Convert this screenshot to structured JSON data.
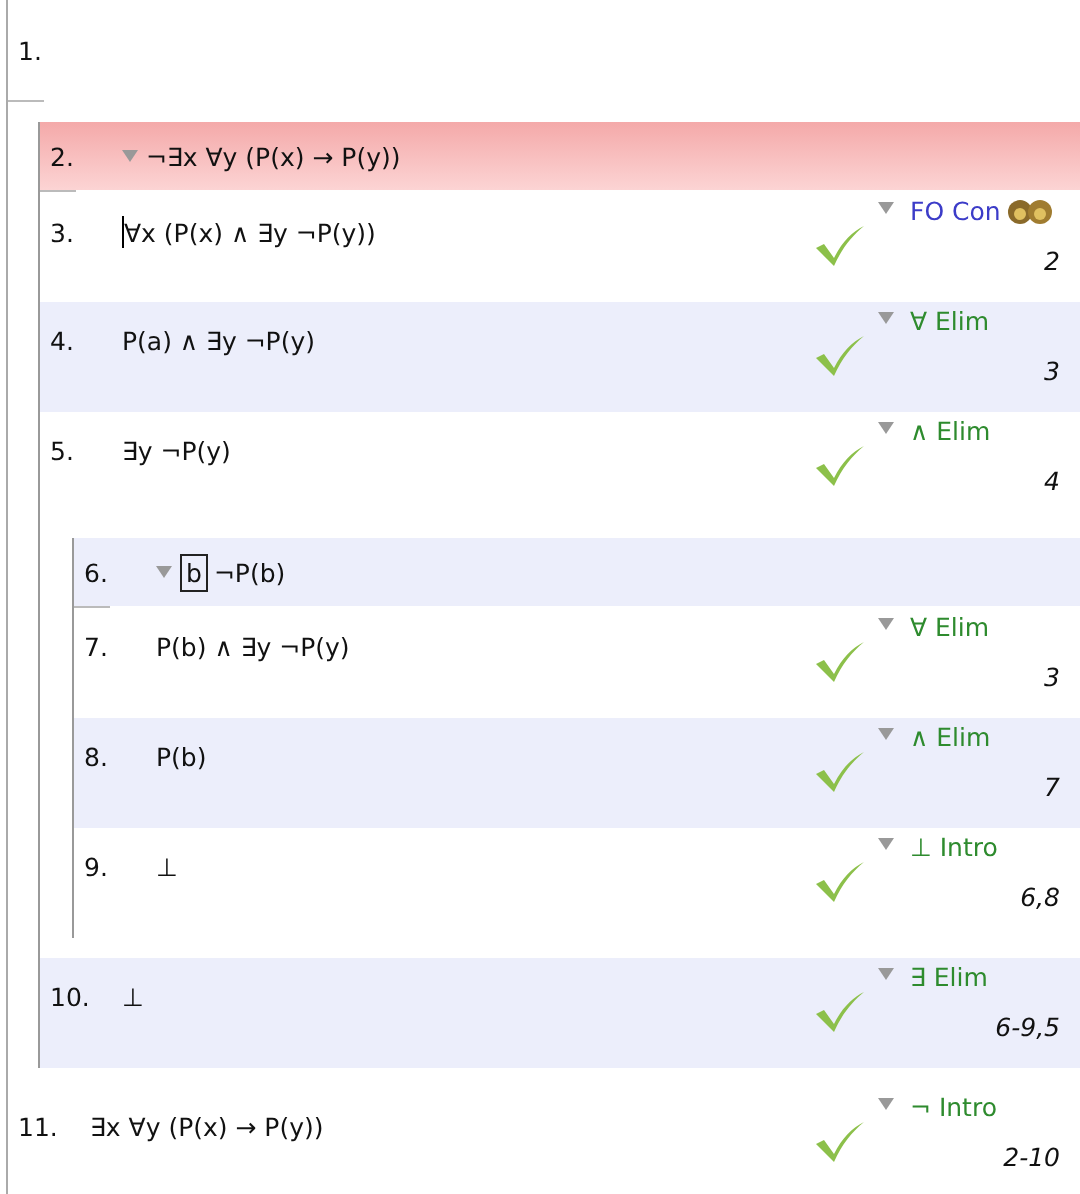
{
  "proof": {
    "lines": [
      {
        "kind": "premise",
        "number": "1.",
        "selected": false,
        "caret": false
      },
      {
        "kind": "subproof",
        "lines": [
          {
            "kind": "assumption",
            "number": "2.",
            "formula": "¬∃x ∀y (P(x) → P(y))",
            "selected": true,
            "caret": false
          },
          {
            "kind": "step",
            "number": "3.",
            "formula": "∀x (P(x) ∧ ∃y ¬P(y))",
            "selected": false,
            "caret": true,
            "rule": {
              "name": "FO Con",
              "color": "#3c3cc8",
              "citation": "2",
              "verified": true,
              "icon": true
            }
          },
          {
            "kind": "step",
            "number": "4.",
            "formula": "P(a) ∧ ∃y ¬P(y)",
            "selected": false,
            "caret": false,
            "rule": {
              "name": "∀ Elim",
              "color": "#2e8b2e",
              "citation": "3",
              "verified": true,
              "icon": false
            }
          },
          {
            "kind": "step",
            "number": "5.",
            "formula": "∃y ¬P(y)",
            "selected": false,
            "caret": false,
            "rule": {
              "name": "∧ Elim",
              "color": "#2e8b2e",
              "citation": "4",
              "verified": true,
              "icon": false
            }
          },
          {
            "kind": "subproof",
            "lines": [
              {
                "kind": "assumption",
                "number": "6.",
                "constant": "b",
                "formula": "¬P(b)",
                "selected": false,
                "caret": false
              },
              {
                "kind": "step",
                "number": "7.",
                "formula": "P(b) ∧ ∃y ¬P(y)",
                "selected": false,
                "caret": false,
                "rule": {
                  "name": "∀ Elim",
                  "color": "#2e8b2e",
                  "citation": "3",
                  "verified": true,
                  "icon": false
                }
              },
              {
                "kind": "step",
                "number": "8.",
                "formula": "P(b)",
                "selected": false,
                "caret": false,
                "rule": {
                  "name": "∧ Elim",
                  "color": "#2e8b2e",
                  "citation": "7",
                  "verified": true,
                  "icon": false
                }
              },
              {
                "kind": "step",
                "number": "9.",
                "formula": "⊥",
                "selected": false,
                "caret": false,
                "rule": {
                  "name": "⊥ Intro",
                  "color": "#2e8b2e",
                  "citation": "6,8",
                  "verified": true,
                  "icon": false
                }
              }
            ]
          },
          {
            "kind": "step",
            "number": "10.",
            "formula": "⊥",
            "selected": false,
            "caret": false,
            "rule": {
              "name": "∃ Elim",
              "color": "#2e8b2e",
              "citation": "6-9,5",
              "verified": true,
              "icon": false
            }
          }
        ]
      },
      {
        "kind": "step",
        "number": "11.",
        "formula": "∃x ∀y (P(x) → P(y))",
        "selected": false,
        "caret": false,
        "rule": {
          "name": "¬ Intro",
          "color": "#2e8b2e",
          "citation": "2-10",
          "verified": true,
          "icon": false
        }
      }
    ]
  }
}
